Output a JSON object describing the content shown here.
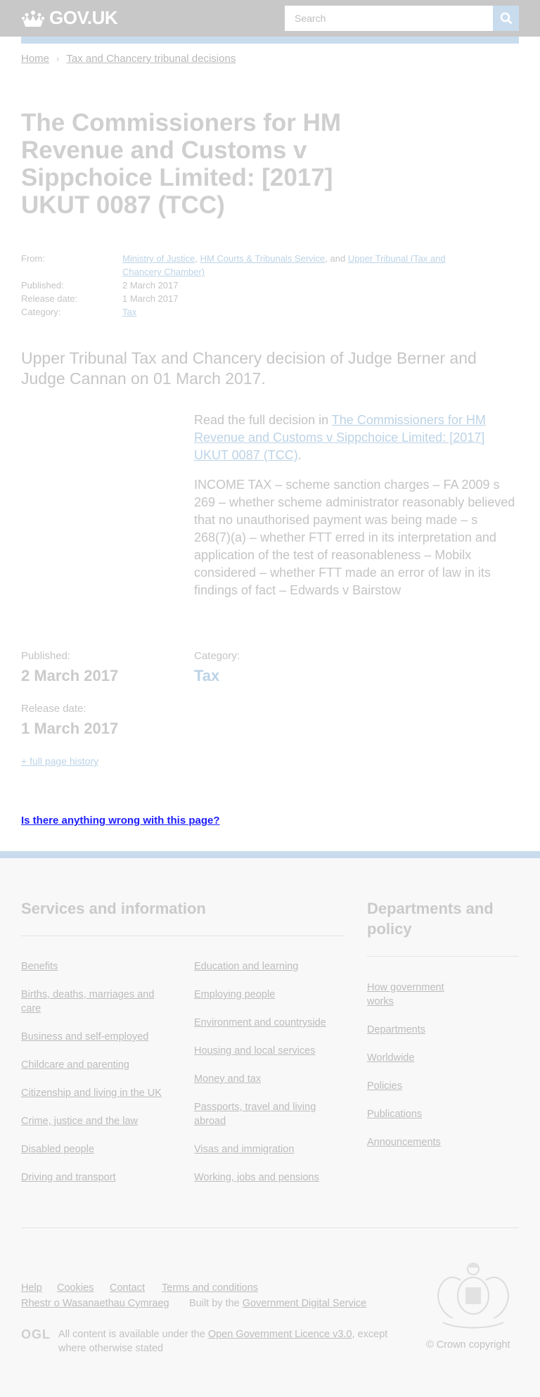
{
  "header": {
    "logo_text": "GOV.UK",
    "search_placeholder": "Search"
  },
  "breadcrumb": {
    "home": "Home",
    "section": "Tax and Chancery tribunal decisions"
  },
  "title": "The Commissioners for HM Revenue and Customs v Sippchoice Limited: [2017] UKUT 0087 (TCC)",
  "metadata": {
    "from_label": "From:",
    "from_org1": "Ministry of Justice",
    "from_sep1": ",",
    "from_org2": "HM Courts & Tribunals Service",
    "from_and": ", and",
    "from_org3": "Upper Tribunal (Tax and Chancery Chamber)",
    "published_label": "Published:",
    "published_value": "2 March 2017",
    "release_label": "Release date:",
    "release_value": "1 March 2017",
    "category_label": "Category:",
    "category_value": "Tax"
  },
  "lead": "Upper Tribunal Tax and Chancery decision of Judge Berner and Judge Cannan on 01 March 2017.",
  "body": {
    "read_prefix": "Read the full decision in ",
    "read_link": "The Commissioners for HM Revenue and Customs v Sippchoice Limited: [2017] UKUT 0087 (TCC)",
    "read_suffix": ".",
    "summary": "INCOME TAX – scheme sanction charges – FA 2009 s 269 – whether scheme administrator reasonably believed that no unauthorised payment was being made – s 268(7)(a) – whether FTT erred in its interpretation and application of the test of reasonableness – Mobilx considered – whether FTT made an error of law in its findings of fact – Edwards v Bairstow"
  },
  "page_footer_meta": {
    "published_label": "Published:",
    "published_value": "2 March 2017",
    "release_label": "Release date:",
    "release_value": "1 March 2017",
    "category_label": "Category:",
    "category_value": "Tax",
    "history_link": "+ full page history"
  },
  "report_link": "Is there anything wrong with this page?",
  "footer": {
    "services_heading": "Services and information",
    "departments_heading": "Departments and policy",
    "services_col1": [
      "Benefits",
      "Births, deaths, marriages and care",
      "Business and self-employed",
      "Childcare and parenting",
      "Citizenship and living in the UK",
      "Crime, justice and the law",
      "Disabled people",
      "Driving and transport"
    ],
    "services_col2": [
      "Education and learning",
      "Employing people",
      "Environment and countryside",
      "Housing and local services",
      "Money and tax",
      "Passports, travel and living abroad",
      "Visas and immigration",
      "Working, jobs and pensions"
    ],
    "departments": [
      "How government works",
      "Departments",
      "Worldwide",
      "Policies",
      "Publications",
      "Announcements"
    ],
    "bottom_links": [
      "Help",
      "Cookies",
      "Contact",
      "Terms and conditions"
    ],
    "welsh_link": "Rhestr o Wasanaethau Cymraeg",
    "built_by": "Built by the ",
    "gds_link": "Government Digital Service",
    "ogl_logo": "OGL",
    "licence_prefix": "All content is available under the ",
    "licence_link": "Open Government Licence v3.0",
    "licence_suffix": ", except where otherwise stated",
    "copyright": "© Crown copyright"
  }
}
